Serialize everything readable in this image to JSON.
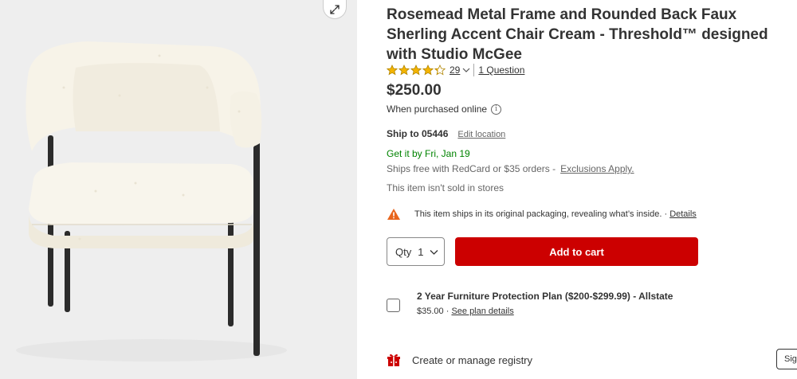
{
  "product": {
    "title": "Rosemead Metal Frame and Rounded Back Faux Sherling Accent Chair Cream - Threshold™ designed with Studio McGee",
    "rating": 4.3,
    "rating_max": 5,
    "review_count": "29",
    "questions_link": "1 Question",
    "price": "$250.00",
    "purchase_note": "When purchased online"
  },
  "shipping": {
    "ship_to": "Ship to 05446",
    "edit_location": "Edit location",
    "get_it": "Get it by Fri, Jan 19",
    "ships_free": "Ships free with RedCard or $35 orders -",
    "exclusions_link": "Exclusions Apply.",
    "not_sold": "This item isn't sold in stores",
    "packaging_note": "This item ships in its original packaging, revealing what’s inside. ·",
    "packaging_details_link": "Details"
  },
  "cart": {
    "qty_label": "Qty",
    "qty_value": "1",
    "add_to_cart": "Add to cart"
  },
  "protection_plan": {
    "title": "2 Year Furniture Protection Plan ($200-$299.99) - Allstate",
    "price": "$35.00 ·",
    "link": "See plan details"
  },
  "registry": {
    "label": "Create or manage registry"
  },
  "signin": {
    "label": "Sign"
  },
  "icons": {
    "zoom": "expand-icon",
    "star": "star-icon",
    "info": "info-icon",
    "warning": "warning-icon",
    "gift": "gift-icon"
  },
  "colors": {
    "brand_red": "#cc0000",
    "star_gold": "#f4b400",
    "delivery_green": "#008300",
    "warning_orange": "#e8651d"
  }
}
